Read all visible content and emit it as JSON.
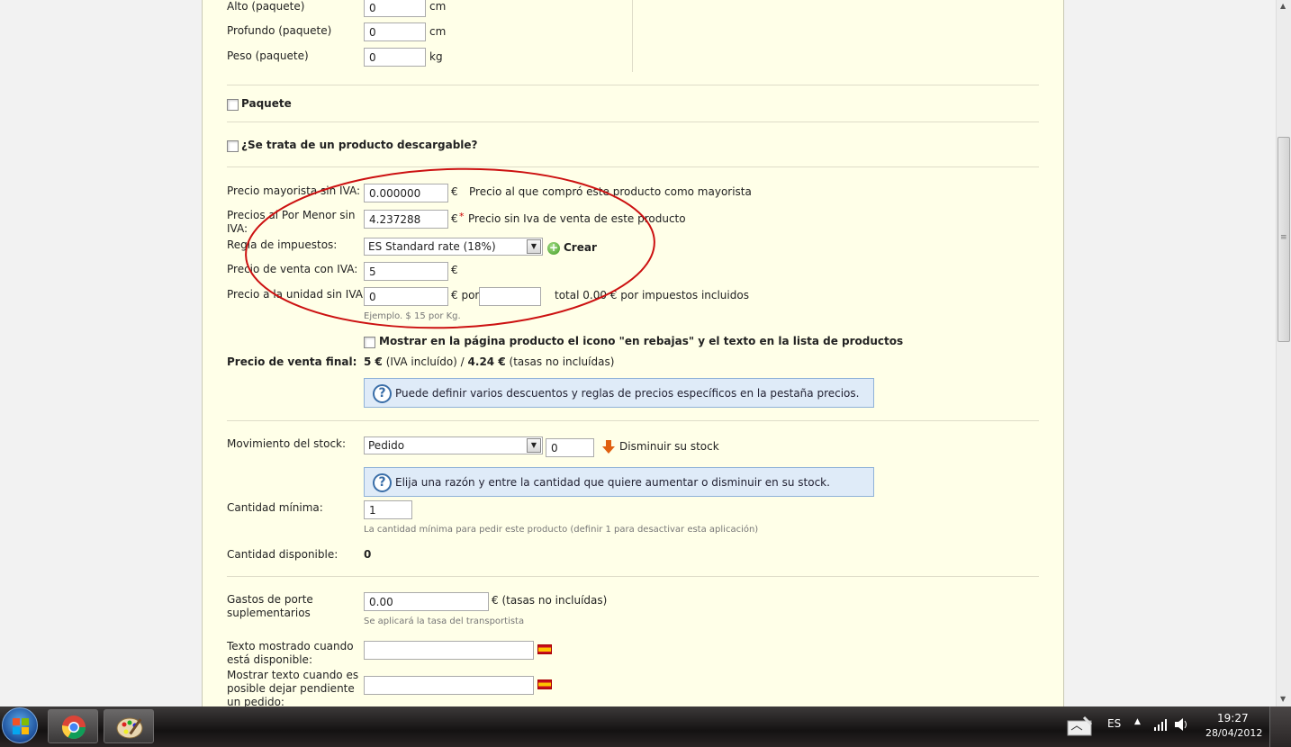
{
  "form": {
    "alto": {
      "label": "Alto (paquete)",
      "value": "0",
      "unit": "cm"
    },
    "profundo": {
      "label": "Profundo (paquete)",
      "value": "0",
      "unit": "cm"
    },
    "peso": {
      "label": "Peso (paquete)",
      "value": "0",
      "unit": "kg"
    },
    "paquete_label": "Paquete",
    "descargable_label": "¿Se trata de un producto descargable?",
    "precio_mayorista": {
      "label": "Precio mayorista sin IVA:",
      "value": "0.000000",
      "currency": "€",
      "hint": "Precio al que compró este producto como mayorista"
    },
    "precio_menor": {
      "label": "Precios al Por Menor sin IVA:",
      "value": "4.237288",
      "currency": "€",
      "required": "*",
      "hint": "Precio sin Iva de venta de este producto"
    },
    "regla_impuestos": {
      "label": "Regla de impuestos:",
      "selected": "ES Standard rate (18%)",
      "create_label": "Crear"
    },
    "precio_venta_iva": {
      "label": "Precio de venta con IVA:",
      "value": "5",
      "currency": "€"
    },
    "precio_unidad": {
      "label": "Precio a la unidad sin IVA",
      "value": "0",
      "per": "€ por",
      "unit_value": "",
      "total_text": "total 0.00 € por impuestos incluidos",
      "example": "Ejemplo. $ 15 por Kg."
    },
    "rebajas_label": "Mostrar en la página producto el icono \"en rebajas\" y el texto en la lista de productos",
    "precio_final": {
      "label": "Precio de venta final:",
      "iva_value": "5 €",
      "iva_text": "(IVA incluído) /",
      "no_tax_value": "4.24 €",
      "no_tax_text": "(tasas no incluídas)"
    },
    "price_hint": "Puede definir varios descuentos y reglas de precios específicos en la pestaña precios.",
    "stock": {
      "label": "Movimiento del stock:",
      "selected": "Pedido",
      "qty": "0",
      "action": "Disminuir su stock"
    },
    "stock_hint": "Elija una razón y entre la cantidad que quiere aumentar o disminuir en su stock.",
    "cantidad_minima": {
      "label": "Cantidad mínima:",
      "value": "1",
      "help": "La cantidad mínima para pedir este producto (definir 1 para desactivar esta aplicación)"
    },
    "cantidad_disponible": {
      "label": "Cantidad disponible:",
      "value": "0"
    },
    "gastos_porte": {
      "label": "Gastos de porte suplementarios",
      "value": "0.00",
      "suffix": "€ (tasas no incluídas)",
      "help": "Se aplicará la tasa del transportista"
    },
    "texto_disponible": {
      "label": "Texto mostrado cuando está disponible:",
      "value": ""
    },
    "texto_pendiente": {
      "label": "Mostrar texto cuando es posible dejar pendiente un pedido:",
      "value": ""
    }
  },
  "taskbar": {
    "language": "ES",
    "time": "19:27",
    "date": "28/04/2012"
  },
  "colors": {
    "panel_bg": "#ffffe8",
    "hint_bg": "#dfebf8",
    "annotation": "#cc1111"
  }
}
